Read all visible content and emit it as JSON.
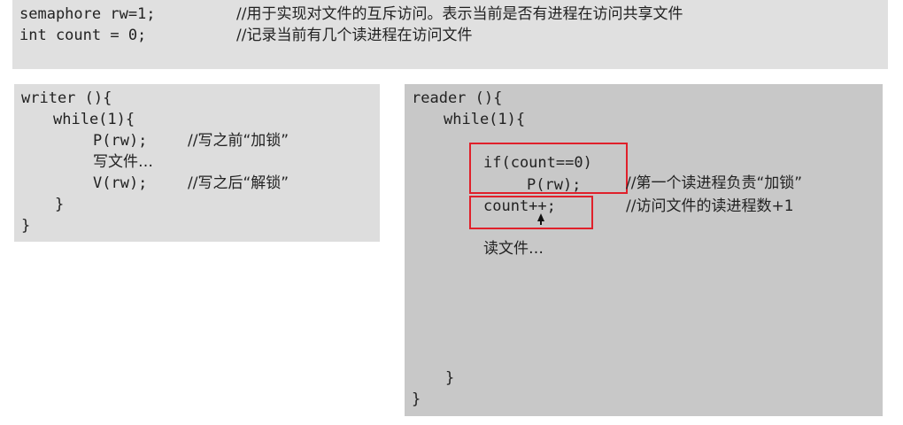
{
  "top": {
    "line1_code": "semaphore rw=1;",
    "line1_comment": "//用于实现对文件的互斥访问。表示当前是否有进程在访问共享文件",
    "line2_code": "int count = 0;",
    "line2_comment": "//记录当前有几个读进程在访问文件"
  },
  "writer": {
    "header": "writer (){",
    "while": "while(1){",
    "p_code": "P(rw);",
    "p_comment": "//写之前“加锁”",
    "write_text": "写文件…",
    "v_code": "V(rw);",
    "v_comment": "//写之后“解锁”",
    "inner_close": "}",
    "outer_close": "}"
  },
  "reader": {
    "header": "reader (){",
    "while": "while(1){",
    "if_line": "if(count==0)",
    "p_code": "P(rw);",
    "p_comment": "//第一个读进程负责“加锁”",
    "count_line": "count++;",
    "count_comment": "//访问文件的读进程数+1",
    "read_text": "读文件…",
    "inner_close": "}",
    "outer_close": "}"
  },
  "colors": {
    "highlight": "#e0202a",
    "top_bg": "#e0e0e0",
    "writer_bg": "#dddddd",
    "reader_bg": "#c8c8c8"
  }
}
